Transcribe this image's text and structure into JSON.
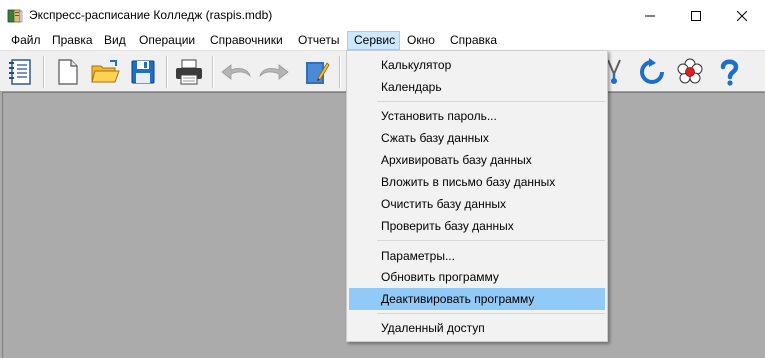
{
  "window": {
    "title": "Экспресс-расписание Колледж (raspis.mdb)"
  },
  "window_controls": [
    "minimize",
    "maximize",
    "close"
  ],
  "menubar": {
    "items": [
      {
        "label": "Файл"
      },
      {
        "label": "Правка"
      },
      {
        "label": "Вид"
      },
      {
        "label": "Операции"
      },
      {
        "label": "Справочники"
      },
      {
        "label": "Отчеты"
      },
      {
        "label": "Сервис",
        "active": true
      },
      {
        "label": "Окно"
      },
      {
        "label": "Справка"
      }
    ]
  },
  "toolbar": {
    "buttons": [
      "notebook-icon",
      "new-document-icon",
      "open-folder-icon",
      "save-floppy-icon",
      "print-icon",
      "undo-arrow-icon",
      "redo-arrow-icon",
      "edit-pencil-icon",
      "cut-icon",
      "refresh-icon",
      "flower-icon",
      "help-icon"
    ]
  },
  "service_menu": {
    "groups": [
      [
        "Калькулятор",
        "Календарь"
      ],
      [
        "Установить пароль...",
        "Сжать базу данных",
        "Архивировать базу данных",
        "Вложить в письмо базу данных",
        "Очистить базу данных",
        "Проверить базу данных"
      ],
      [
        "Параметры...",
        "Обновить программу",
        "Деактивировать программу"
      ],
      [
        "Удаленный доступ"
      ]
    ],
    "highlighted": "Деактивировать программу"
  },
  "colors": {
    "workspace": "#ababab",
    "menu_active_bg": "#cce8ff",
    "menu_highlight": "#91c9f7",
    "icon_blue": "#1e6fc8"
  }
}
